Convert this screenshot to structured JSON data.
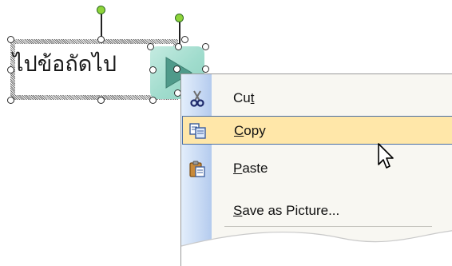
{
  "textbox": {
    "text": "ไปข้อถัดไป"
  },
  "context_menu": {
    "items": [
      {
        "id": "cut",
        "label_before": "Cu",
        "mnemonic": "t",
        "label_after": "",
        "icon": "scissors-icon",
        "highlighted": false
      },
      {
        "id": "copy",
        "label_before": "",
        "mnemonic": "C",
        "label_after": "opy",
        "icon": "copy-icon",
        "highlighted": true
      },
      {
        "id": "paste",
        "label_before": "",
        "mnemonic": "P",
        "label_after": "aste",
        "icon": "paste-icon",
        "highlighted": false
      },
      {
        "id": "save_as_picture",
        "label_before": "",
        "mnemonic": "S",
        "label_after": "ave as Picture...",
        "icon": "",
        "highlighted": false
      }
    ]
  },
  "colors": {
    "highlight_bg": "#ffe7a9",
    "highlight_border": "#4a6fa5",
    "gutter": "#c8daf4",
    "action_button": "#a0dccd",
    "rotation_handle": "#8ed43a"
  }
}
